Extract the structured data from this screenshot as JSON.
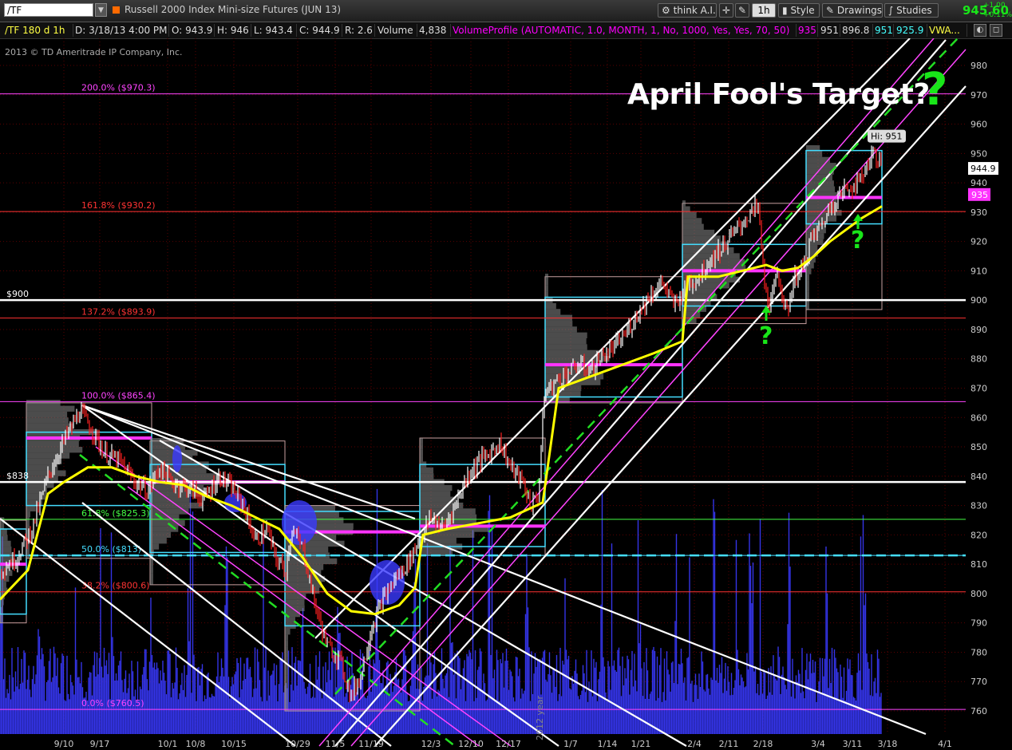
{
  "toolbar": {
    "symbol": "/TF",
    "instrument": "Russell 2000 Index Mini-size Futures (JUN 13)",
    "think_ai": "think A.I.",
    "timeframe": "1h",
    "style": "Style",
    "drawings": "Drawings",
    "studies": "Studies",
    "last_price": "945.60",
    "change_abs": "+1.00",
    "change_pct": "+0.11%"
  },
  "infobar": {
    "descriptor": "/TF 180 d 1h",
    "date": "D: 3/18/13 4:00 PM",
    "open": "O: 943.9",
    "high": "H: 946",
    "low": "L: 943.4",
    "close": "C: 944.9",
    "range": "R: 2.6",
    "volume_label": "Volume",
    "volume_value": "4,838",
    "volume_profile": "VolumeProfile (AUTOMATIC, 1.0, MONTH, 1, No, 1000, Yes, Yes, 70, 50)",
    "vp_poc": "935",
    "vp_high": "951",
    "vp_low": "896.8",
    "vp_va_high": "951",
    "vp_va_low": "925.9",
    "vwap": "VWA..."
  },
  "copyright": "2013 © TD Ameritrade IP Company, Inc.",
  "annotations": {
    "headline": "April Fool's Target?",
    "question_mark": "?"
  },
  "colors": {
    "background": "#000000",
    "grid": "#5a0000",
    "up_bar": "#ffffff",
    "down_bar": "#ff2020",
    "volume": "#3a3aff",
    "moving_average": "#ffff00",
    "fib_pink": "#ff44ff",
    "fib_red": "#ff3333",
    "fib_green": "#44ff44",
    "value_area": "#44ddff",
    "poc": "#ff33ff",
    "trend_white": "#ffffff",
    "trend_green_dashed": "#22dd22",
    "annotation_green": "#19e619"
  },
  "chart_data": {
    "type": "candlestick",
    "timeframe": "1h",
    "ylim": [
      752,
      990
    ],
    "y_ticks": [
      760,
      770,
      780,
      790,
      800,
      810,
      820,
      830,
      840,
      850,
      860,
      870,
      880,
      890,
      900,
      910,
      920,
      930,
      940,
      950,
      960,
      970,
      980
    ],
    "x_tick_labels": [
      "9/10",
      "9/17",
      "10/1",
      "10/8",
      "10/15",
      "10/29",
      "11/5",
      "11/19",
      "12/3",
      "12/10",
      "12/17",
      "1/7",
      "1/14",
      "1/21",
      "2/4",
      "2/11",
      "2/18",
      "3/4",
      "3/11",
      "3/18",
      "4/1"
    ],
    "year_label": "2012 year",
    "last_close": 944.9,
    "last_close_label": "944.9",
    "poc_label": "935",
    "high_label": "Hi: 951",
    "high_value": 951,
    "price_path": [
      [
        0,
        808
      ],
      [
        20,
        812
      ],
      [
        40,
        822
      ],
      [
        60,
        840
      ],
      [
        80,
        852
      ],
      [
        100,
        862
      ],
      [
        115,
        856
      ],
      [
        130,
        848
      ],
      [
        150,
        845
      ],
      [
        170,
        838
      ],
      [
        185,
        835
      ],
      [
        200,
        843
      ],
      [
        215,
        838
      ],
      [
        235,
        836
      ],
      [
        255,
        832
      ],
      [
        275,
        840
      ],
      [
        290,
        836
      ],
      [
        305,
        830
      ],
      [
        320,
        818
      ],
      [
        335,
        822
      ],
      [
        345,
        812
      ],
      [
        358,
        808
      ],
      [
        365,
        822
      ],
      [
        380,
        815
      ],
      [
        395,
        796
      ],
      [
        410,
        782
      ],
      [
        425,
        778
      ],
      [
        440,
        765
      ],
      [
        452,
        772
      ],
      [
        465,
        788
      ],
      [
        480,
        798
      ],
      [
        495,
        805
      ],
      [
        510,
        810
      ],
      [
        525,
        818
      ],
      [
        540,
        826
      ],
      [
        555,
        822
      ],
      [
        570,
        830
      ],
      [
        585,
        840
      ],
      [
        600,
        845
      ],
      [
        615,
        848
      ],
      [
        625,
        852
      ],
      [
        640,
        843
      ],
      [
        655,
        838
      ],
      [
        665,
        830
      ],
      [
        675,
        834
      ],
      [
        682,
        868
      ],
      [
        695,
        872
      ],
      [
        710,
        875
      ],
      [
        725,
        878
      ],
      [
        740,
        876
      ],
      [
        755,
        881
      ],
      [
        770,
        884
      ],
      [
        785,
        889
      ],
      [
        800,
        896
      ],
      [
        815,
        902
      ],
      [
        830,
        906
      ],
      [
        845,
        898
      ],
      [
        860,
        905
      ],
      [
        875,
        908
      ],
      [
        890,
        914
      ],
      [
        905,
        918
      ],
      [
        920,
        923
      ],
      [
        935,
        928
      ],
      [
        950,
        932
      ],
      [
        958,
        905
      ],
      [
        965,
        898
      ],
      [
        975,
        910
      ],
      [
        985,
        894
      ],
      [
        995,
        908
      ],
      [
        1005,
        910
      ],
      [
        1015,
        920
      ],
      [
        1030,
        926
      ],
      [
        1045,
        934
      ],
      [
        1060,
        938
      ],
      [
        1075,
        940
      ],
      [
        1090,
        948
      ],
      [
        1095,
        951
      ],
      [
        1105,
        944.9
      ]
    ],
    "moving_average": [
      [
        0,
        798
      ],
      [
        35,
        808
      ],
      [
        60,
        834
      ],
      [
        80,
        838
      ],
      [
        110,
        843
      ],
      [
        140,
        843
      ],
      [
        170,
        840
      ],
      [
        200,
        838
      ],
      [
        230,
        837
      ],
      [
        260,
        833
      ],
      [
        290,
        830
      ],
      [
        320,
        826
      ],
      [
        350,
        822
      ],
      [
        380,
        812
      ],
      [
        410,
        800
      ],
      [
        440,
        794
      ],
      [
        470,
        793
      ],
      [
        500,
        796
      ],
      [
        520,
        802
      ],
      [
        530,
        820
      ],
      [
        560,
        822
      ],
      [
        600,
        824
      ],
      [
        640,
        826
      ],
      [
        680,
        831
      ],
      [
        700,
        870
      ],
      [
        740,
        874
      ],
      [
        780,
        878
      ],
      [
        820,
        882
      ],
      [
        855,
        886
      ],
      [
        862,
        908
      ],
      [
        900,
        908
      ],
      [
        930,
        910
      ],
      [
        960,
        912
      ],
      [
        980,
        910
      ],
      [
        1000,
        911
      ],
      [
        1020,
        915
      ],
      [
        1040,
        920
      ],
      [
        1060,
        924
      ],
      [
        1080,
        928
      ],
      [
        1105,
        932
      ]
    ],
    "fibonacci": [
      {
        "pct": "200.0%",
        "value": 970.3,
        "label": "200.0%  ($970.3)",
        "color": "#ff44ff"
      },
      {
        "pct": "161.8%",
        "value": 930.2,
        "label": "161.8%  ($930.2)",
        "color": "#ff3333"
      },
      {
        "pct": "137.2%",
        "value": 893.9,
        "label": "137.2%  ($893.9)",
        "color": "#ff3333"
      },
      {
        "pct": "100.0%",
        "value": 865.4,
        "label": "100.0%  ($865.4)",
        "color": "#ff44ff"
      },
      {
        "pct": "61.8%",
        "value": 825.3,
        "label": "61.8%  ($825.3)",
        "color": "#44ff44"
      },
      {
        "pct": "50.0%",
        "value": 813,
        "label": "50.0%  ($813)",
        "color": "#44ddff"
      },
      {
        "pct": "38.2%",
        "value": 800.6,
        "label": "38.2%  ($800.6)",
        "color": "#ff3333"
      },
      {
        "pct": "0.0%",
        "value": 760.5,
        "label": "0.0%  ($760.5)",
        "color": "#ff44ff"
      }
    ],
    "horizontal_levels": [
      {
        "value": 900,
        "label": "$900"
      },
      {
        "value": 838,
        "label": "$838"
      }
    ],
    "volume_profiles": [
      {
        "x0": 0,
        "x1": 33,
        "poc": 810,
        "va_high": 822,
        "va_low": 793,
        "hi": 825,
        "lo": 790
      },
      {
        "x0": 33,
        "x1": 190,
        "poc": 853,
        "va_high": 855,
        "va_low": 830,
        "hi": 865,
        "lo": 812
      },
      {
        "x0": 188,
        "x1": 357,
        "poc": 838,
        "va_high": 844,
        "va_low": 814,
        "hi": 852,
        "lo": 803
      },
      {
        "x0": 357,
        "x1": 526,
        "poc": 821,
        "va_high": 828,
        "va_low": 789,
        "hi": 830,
        "lo": 760
      },
      {
        "x0": 526,
        "x1": 683,
        "poc": 823,
        "va_high": 844,
        "va_low": 816,
        "hi": 853,
        "lo": 813
      },
      {
        "x0": 683,
        "x1": 855,
        "poc": 878,
        "va_high": 901,
        "va_low": 867,
        "hi": 908,
        "lo": 865
      },
      {
        "x0": 855,
        "x1": 1010,
        "poc": 910,
        "va_high": 919,
        "va_low": 898,
        "hi": 933,
        "lo": 892
      },
      {
        "x0": 1010,
        "x1": 1105,
        "poc": 935,
        "va_high": 951,
        "va_low": 926,
        "hi": 951,
        "lo": 896.8
      }
    ]
  }
}
